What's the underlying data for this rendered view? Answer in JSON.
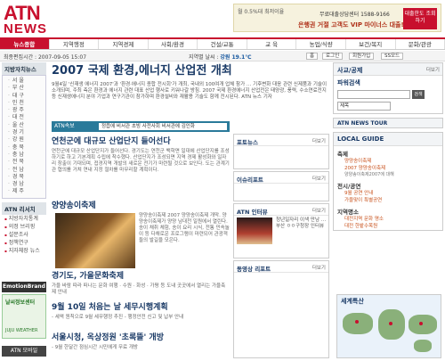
{
  "brand": {
    "line1": "ATN",
    "line2": "NEWS"
  },
  "ad_top": {
    "rate": "월 0.5%대 최저이율",
    "phone": "무료대출상담센터 1588-9166",
    "slogan": "은행권 거절 고객도 VIP 마이너스 대출!",
    "button": "대출한도 조회하기"
  },
  "nav": [
    "뉴스종합",
    "지역행정",
    "지역경제",
    "사회/환경",
    "건설/교통",
    "교 육",
    "농업/식량",
    "보건/복지",
    "문화/관광"
  ],
  "subbar": {
    "updated": "최종편집시간 : 2007-09-05 15:07",
    "weather_label": "지역별 날씨 :",
    "weather_value": "강원 19.1℃",
    "buttons": [
      "홈",
      "로그인",
      "회원가입",
      "SS모드"
    ]
  },
  "left": {
    "region_title": "지방자치뉴스",
    "regions": [
      "서 울",
      "부 산",
      "대 구",
      "인 천",
      "광 주",
      "대 전",
      "울 산",
      "경 기",
      "강 원",
      "충 북",
      "충 남",
      "전 북",
      "전 남",
      "경 북",
      "경 남",
      "제 주"
    ],
    "stats_title": "ATN 리서치",
    "stats": [
      "지방자치통계",
      "의정 브리핑",
      "설문조사",
      "정책연구",
      "지자체장 뉴스"
    ],
    "ad_emotion": "EmotionBrand",
    "ad_weather_title": "날씨정보센터",
    "ad_weather_sub": "JUJU WEATHER",
    "mobile": "ATN 모바일"
  },
  "center": {
    "headline": "2007 국제 환경,에너지 산업전 개최",
    "lead": "9월4일 '신재생 에너지 2007'과 '환경·에너지 종합 전시회'가 개최, 국내외 100여개 업체 참가 … 기후변화 대응 관련 신제품과 기술이 소개되며, 주최 측은 환경과 에너지 관련 대표 산업 행사로 키워나갈 방침. 2007 국제 환경에너지 산업전은 태양광, 풍력, 수소연료전지 등 신재생에너지 분야 기업과 연구기관이 참가하며 환경설비와 재활용 기술도 함께 전시된다. ATN 뉴스 기자",
    "banner_label": "ATN속보",
    "banner_ticker": "정읍에 비서관 초빙 사전사회 비서관에 김인화",
    "story1_title": "연천군에 대규모 산업단지 들어선다",
    "story1_body": "연천군에 대규모 산업단지가 들어선다. 경기도는 연천군 백학면 일대에 산업단지를 조성하기로 하고 기본계획 수립에 착수했다. 산업단지가 조성되면 지역 경제 활성화와 일자리 창출이 기대되며, 접경지역 개발의 새로운 전기가 마련될 것으로 보인다. 도는 관계기관 협의를 거쳐 연내 지정 절차를 마무리할 계획이다.",
    "story2_title": "양양송이축제",
    "festival_text": "양양송이축제 2007 양양송이축제 개막. 양양송이축제가 양양 남대천 일원에서 열린다. 송이 채취 체험, 송이 요리 시식, 전통 민속놀이 등 다채로운 프로그램이 마련되어 관광객들의 발길을 모은다.",
    "story3_title": "경기도, 가을문화축제",
    "story3_body": "가을 바람 따라 떠나는 문화 여행 · 수원 · 화성 · 가평 등 도내 곳곳에서 열리는 가을축제 안내",
    "story4_title": "9월 10일 처음는 날 세무시행계획",
    "story4_body": "- 세액 원칙으로 9월 세무행정 추진 - 행정안전 신고 및 납부 안내",
    "story5_title": "서울시청, 옥상정원 '초록뜰' 개방",
    "story5_body": "- 9월 한달간 점심시간 시민에게 무료 개방"
  },
  "mid": {
    "panel1_title": "포토뉴스",
    "panel2_title": "이슈리포트",
    "panel3_title": "ATN 인터뷰",
    "interview_text": "청년일자리 이색 만남 … 부산 ㅇㅇ구청장 인터뷰",
    "panel4_title": "동영상 리포트",
    "more": "더보기"
  },
  "right": {
    "tour_title": "사교/공제",
    "search_label": "파워검색",
    "search_placeholder": "",
    "search_button": "검색",
    "search_select": "제목",
    "news_tour": "ATN NEWS TOUR",
    "guide_title": "LOCAL GUIDE",
    "guide_sections": [
      {
        "title": "축제",
        "links": [
          "양양송이축제",
          "2007 양양송이축제"
        ],
        "sub": "양양송이축제2007에 대해"
      },
      {
        "title": "전시/공연",
        "links": [
          "9월 공연 안내",
          "가을맞이 특별공연"
        ],
        "sub": ""
      },
      {
        "title": "지역명소",
        "links": [
          "대전지역 문화 명소",
          "대전 한밭수목원"
        ],
        "sub": ""
      }
    ],
    "map_title": "세계특산",
    "more": "더보기"
  }
}
